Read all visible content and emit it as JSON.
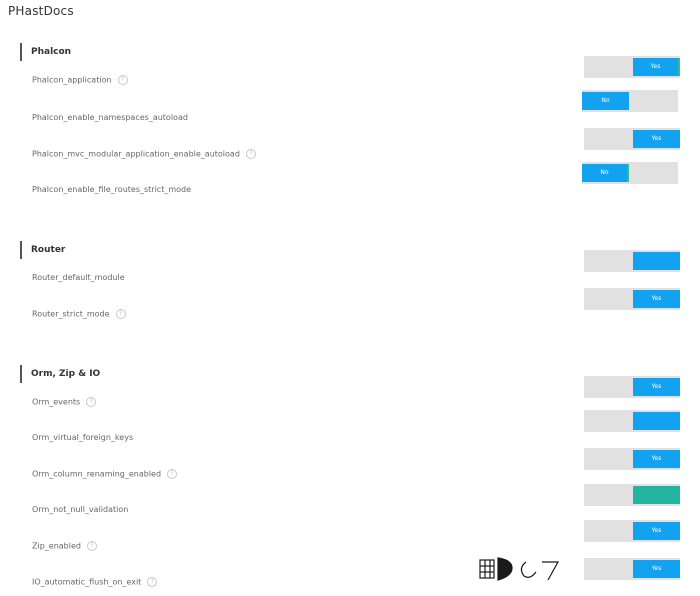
{
  "title": "PHastDocs",
  "sections": [
    {
      "heading": "Phalcon",
      "rows": [
        {
          "label": "Phalcon_application",
          "help": true,
          "state": "on",
          "knob_text": "Yes"
        },
        {
          "label": "Phalcon_enable_namespaces_autoload",
          "help": false,
          "state": "off",
          "knob_text": "No"
        },
        {
          "label": "Phalcon_mvc_modular_application_enable_autoload",
          "help": true,
          "state": "on",
          "knob_text": "Yes"
        },
        {
          "label": "Phalcon_enable_file_routes_strict_mode",
          "help": false,
          "state": "off",
          "knob_text": "No"
        }
      ]
    },
    {
      "heading": "Router",
      "rows": [
        {
          "label": "Router_default_module",
          "help": false,
          "state": "on",
          "knob_text": ""
        },
        {
          "label": "Router_strict_mode",
          "help": true,
          "state": "on",
          "knob_text": "Yes"
        }
      ]
    },
    {
      "heading": "Orm, Zip & IO",
      "rows": [
        {
          "label": "Orm_events",
          "help": true,
          "state": "on",
          "knob_text": "Yes"
        },
        {
          "label": "Orm_virtual_foreign_keys",
          "help": false,
          "state": "on",
          "knob_text": ""
        },
        {
          "label": "Orm_column_renaming_enabled",
          "help": true,
          "state": "on",
          "knob_text": "Yes"
        },
        {
          "label": "Orm_not_null_validation",
          "help": false,
          "state": "on",
          "knob_text": ""
        },
        {
          "label": "Zip_enabled",
          "help": true,
          "state": "on",
          "knob_text": "Yes"
        },
        {
          "label": "IO_automatic_flush_on_exit",
          "help": true,
          "state": "on",
          "knob_text": "Yes"
        }
      ]
    }
  ],
  "colors": {
    "knob": "#12a2f0",
    "knob_alt": "#22b4a0",
    "track": "#e1e1e1"
  }
}
